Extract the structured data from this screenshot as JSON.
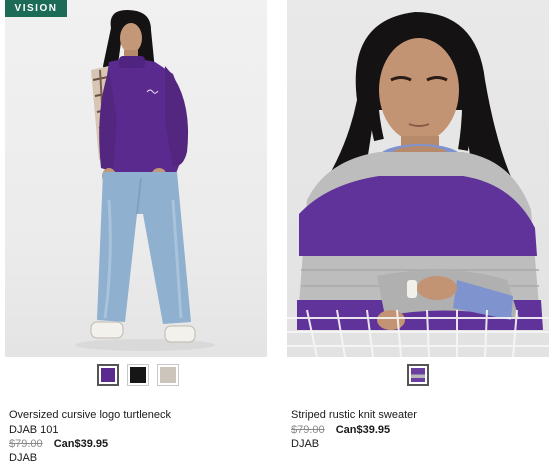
{
  "products": [
    {
      "badge": "VISION",
      "name": "Oversized cursive logo turtleneck",
      "brand": "DJAB 101",
      "price_old": "$79.00",
      "price_new": "Can$39.95",
      "brand_secondary": "DJAB",
      "image_alt": "Model wearing purple oversized turtleneck, plaid shirt and light-wash jeans",
      "swatches": [
        {
          "name": "purple",
          "color": "#5b2a8f",
          "selected": true
        },
        {
          "name": "black",
          "color": "#161616",
          "selected": false
        },
        {
          "name": "beige",
          "color": "#cbc5bb",
          "selected": false
        }
      ]
    },
    {
      "name": "Striped rustic knit sweater",
      "price_old": "$79.00",
      "price_new": "Can$39.95",
      "brand": "DJAB",
      "image_alt": "Model wearing purple and grey striped knit sweater seated on a wire chair",
      "swatches": [
        {
          "name": "purple-grey-stripe",
          "color": "#6a3fa0",
          "selected": true
        }
      ]
    }
  ],
  "colors": {
    "badge_bg": "#1c6b57",
    "old_price": "#8a8a8a"
  }
}
